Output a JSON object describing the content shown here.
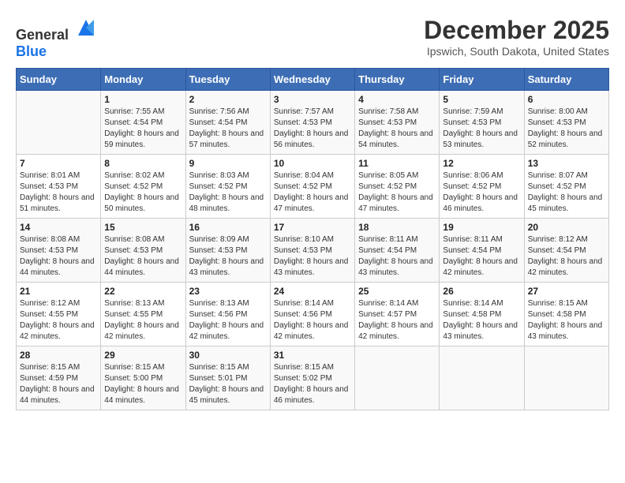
{
  "header": {
    "logo_general": "General",
    "logo_blue": "Blue",
    "title": "December 2025",
    "subtitle": "Ipswich, South Dakota, United States"
  },
  "days_of_week": [
    "Sunday",
    "Monday",
    "Tuesday",
    "Wednesday",
    "Thursday",
    "Friday",
    "Saturday"
  ],
  "weeks": [
    [
      {
        "day": "",
        "sunrise": "",
        "sunset": "",
        "daylight": ""
      },
      {
        "day": "1",
        "sunrise": "Sunrise: 7:55 AM",
        "sunset": "Sunset: 4:54 PM",
        "daylight": "Daylight: 8 hours and 59 minutes."
      },
      {
        "day": "2",
        "sunrise": "Sunrise: 7:56 AM",
        "sunset": "Sunset: 4:54 PM",
        "daylight": "Daylight: 8 hours and 57 minutes."
      },
      {
        "day": "3",
        "sunrise": "Sunrise: 7:57 AM",
        "sunset": "Sunset: 4:53 PM",
        "daylight": "Daylight: 8 hours and 56 minutes."
      },
      {
        "day": "4",
        "sunrise": "Sunrise: 7:58 AM",
        "sunset": "Sunset: 4:53 PM",
        "daylight": "Daylight: 8 hours and 54 minutes."
      },
      {
        "day": "5",
        "sunrise": "Sunrise: 7:59 AM",
        "sunset": "Sunset: 4:53 PM",
        "daylight": "Daylight: 8 hours and 53 minutes."
      },
      {
        "day": "6",
        "sunrise": "Sunrise: 8:00 AM",
        "sunset": "Sunset: 4:53 PM",
        "daylight": "Daylight: 8 hours and 52 minutes."
      }
    ],
    [
      {
        "day": "7",
        "sunrise": "Sunrise: 8:01 AM",
        "sunset": "Sunset: 4:53 PM",
        "daylight": "Daylight: 8 hours and 51 minutes."
      },
      {
        "day": "8",
        "sunrise": "Sunrise: 8:02 AM",
        "sunset": "Sunset: 4:52 PM",
        "daylight": "Daylight: 8 hours and 50 minutes."
      },
      {
        "day": "9",
        "sunrise": "Sunrise: 8:03 AM",
        "sunset": "Sunset: 4:52 PM",
        "daylight": "Daylight: 8 hours and 48 minutes."
      },
      {
        "day": "10",
        "sunrise": "Sunrise: 8:04 AM",
        "sunset": "Sunset: 4:52 PM",
        "daylight": "Daylight: 8 hours and 47 minutes."
      },
      {
        "day": "11",
        "sunrise": "Sunrise: 8:05 AM",
        "sunset": "Sunset: 4:52 PM",
        "daylight": "Daylight: 8 hours and 47 minutes."
      },
      {
        "day": "12",
        "sunrise": "Sunrise: 8:06 AM",
        "sunset": "Sunset: 4:52 PM",
        "daylight": "Daylight: 8 hours and 46 minutes."
      },
      {
        "day": "13",
        "sunrise": "Sunrise: 8:07 AM",
        "sunset": "Sunset: 4:52 PM",
        "daylight": "Daylight: 8 hours and 45 minutes."
      }
    ],
    [
      {
        "day": "14",
        "sunrise": "Sunrise: 8:08 AM",
        "sunset": "Sunset: 4:53 PM",
        "daylight": "Daylight: 8 hours and 44 minutes."
      },
      {
        "day": "15",
        "sunrise": "Sunrise: 8:08 AM",
        "sunset": "Sunset: 4:53 PM",
        "daylight": "Daylight: 8 hours and 44 minutes."
      },
      {
        "day": "16",
        "sunrise": "Sunrise: 8:09 AM",
        "sunset": "Sunset: 4:53 PM",
        "daylight": "Daylight: 8 hours and 43 minutes."
      },
      {
        "day": "17",
        "sunrise": "Sunrise: 8:10 AM",
        "sunset": "Sunset: 4:53 PM",
        "daylight": "Daylight: 8 hours and 43 minutes."
      },
      {
        "day": "18",
        "sunrise": "Sunrise: 8:11 AM",
        "sunset": "Sunset: 4:54 PM",
        "daylight": "Daylight: 8 hours and 43 minutes."
      },
      {
        "day": "19",
        "sunrise": "Sunrise: 8:11 AM",
        "sunset": "Sunset: 4:54 PM",
        "daylight": "Daylight: 8 hours and 42 minutes."
      },
      {
        "day": "20",
        "sunrise": "Sunrise: 8:12 AM",
        "sunset": "Sunset: 4:54 PM",
        "daylight": "Daylight: 8 hours and 42 minutes."
      }
    ],
    [
      {
        "day": "21",
        "sunrise": "Sunrise: 8:12 AM",
        "sunset": "Sunset: 4:55 PM",
        "daylight": "Daylight: 8 hours and 42 minutes."
      },
      {
        "day": "22",
        "sunrise": "Sunrise: 8:13 AM",
        "sunset": "Sunset: 4:55 PM",
        "daylight": "Daylight: 8 hours and 42 minutes."
      },
      {
        "day": "23",
        "sunrise": "Sunrise: 8:13 AM",
        "sunset": "Sunset: 4:56 PM",
        "daylight": "Daylight: 8 hours and 42 minutes."
      },
      {
        "day": "24",
        "sunrise": "Sunrise: 8:14 AM",
        "sunset": "Sunset: 4:56 PM",
        "daylight": "Daylight: 8 hours and 42 minutes."
      },
      {
        "day": "25",
        "sunrise": "Sunrise: 8:14 AM",
        "sunset": "Sunset: 4:57 PM",
        "daylight": "Daylight: 8 hours and 42 minutes."
      },
      {
        "day": "26",
        "sunrise": "Sunrise: 8:14 AM",
        "sunset": "Sunset: 4:58 PM",
        "daylight": "Daylight: 8 hours and 43 minutes."
      },
      {
        "day": "27",
        "sunrise": "Sunrise: 8:15 AM",
        "sunset": "Sunset: 4:58 PM",
        "daylight": "Daylight: 8 hours and 43 minutes."
      }
    ],
    [
      {
        "day": "28",
        "sunrise": "Sunrise: 8:15 AM",
        "sunset": "Sunset: 4:59 PM",
        "daylight": "Daylight: 8 hours and 44 minutes."
      },
      {
        "day": "29",
        "sunrise": "Sunrise: 8:15 AM",
        "sunset": "Sunset: 5:00 PM",
        "daylight": "Daylight: 8 hours and 44 minutes."
      },
      {
        "day": "30",
        "sunrise": "Sunrise: 8:15 AM",
        "sunset": "Sunset: 5:01 PM",
        "daylight": "Daylight: 8 hours and 45 minutes."
      },
      {
        "day": "31",
        "sunrise": "Sunrise: 8:15 AM",
        "sunset": "Sunset: 5:02 PM",
        "daylight": "Daylight: 8 hours and 46 minutes."
      },
      {
        "day": "",
        "sunrise": "",
        "sunset": "",
        "daylight": ""
      },
      {
        "day": "",
        "sunrise": "",
        "sunset": "",
        "daylight": ""
      },
      {
        "day": "",
        "sunrise": "",
        "sunset": "",
        "daylight": ""
      }
    ]
  ]
}
